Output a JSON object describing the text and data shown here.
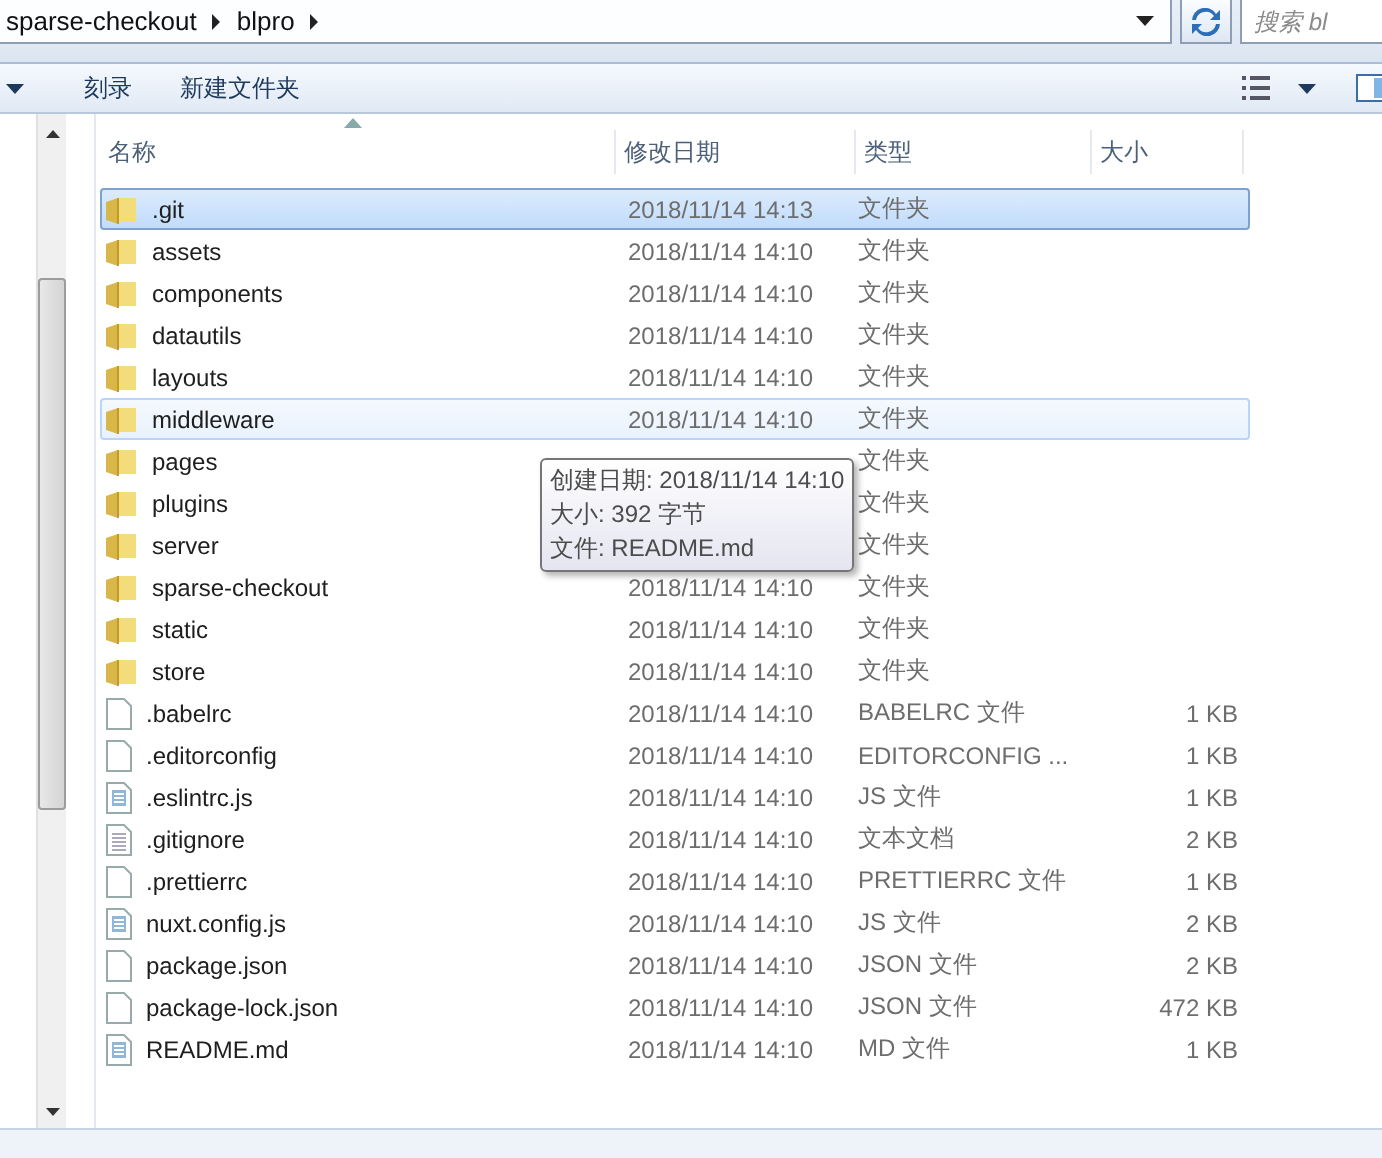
{
  "address_bar": {
    "crumbs": [
      "sparse-checkout",
      "blpro"
    ],
    "search_placeholder": "搜索 bl"
  },
  "toolbar": {
    "buttons": [
      "刻录",
      "新建文件夹"
    ]
  },
  "columns": [
    "名称",
    "修改日期",
    "类型",
    "大小"
  ],
  "files": [
    {
      "name": ".git",
      "date": "2018/11/14 14:13",
      "type": "文件夹",
      "kind": "folder",
      "selected": true,
      "hovered": false
    },
    {
      "name": "assets",
      "date": "2018/11/14 14:10",
      "type": "文件夹",
      "kind": "folder",
      "selected": false,
      "hovered": false
    },
    {
      "name": "components",
      "date": "2018/11/14 14:10",
      "type": "文件夹",
      "kind": "folder",
      "selected": false,
      "hovered": false
    },
    {
      "name": "datautils",
      "date": "2018/11/14 14:10",
      "type": "文件夹",
      "kind": "folder",
      "selected": false,
      "hovered": false
    },
    {
      "name": "layouts",
      "date": "2018/11/14 14:10",
      "type": "文件夹",
      "kind": "folder",
      "selected": false,
      "hovered": false
    },
    {
      "name": "middleware",
      "date": "2018/11/14 14:10",
      "type": "文件夹",
      "kind": "folder",
      "selected": false,
      "hovered": true
    },
    {
      "name": "pages",
      "type": "文件夹",
      "kind": "folder",
      "selected": false,
      "hovered": false
    },
    {
      "name": "plugins",
      "type": "文件夹",
      "kind": "folder",
      "selected": false,
      "hovered": false
    },
    {
      "name": "server",
      "type": "文件夹",
      "kind": "folder",
      "selected": false,
      "hovered": false
    },
    {
      "name": "sparse-checkout",
      "date": "2018/11/14 14:10",
      "type": "文件夹",
      "kind": "folder",
      "selected": false,
      "hovered": false
    },
    {
      "name": "static",
      "date": "2018/11/14 14:10",
      "type": "文件夹",
      "kind": "folder",
      "selected": false,
      "hovered": false
    },
    {
      "name": "store",
      "date": "2018/11/14 14:10",
      "type": "文件夹",
      "kind": "folder",
      "selected": false,
      "hovered": false
    },
    {
      "name": ".babelrc",
      "date": "2018/11/14 14:10",
      "type": "BABELRC 文件",
      "size": "1 KB",
      "kind": "blank",
      "selected": false,
      "hovered": false
    },
    {
      "name": ".editorconfig",
      "date": "2018/11/14 14:10",
      "type": "EDITORCONFIG ...",
      "size": "1 KB",
      "kind": "blank",
      "selected": false,
      "hovered": false
    },
    {
      "name": ".eslintrc.js",
      "date": "2018/11/14 14:10",
      "type": "JS 文件",
      "size": "1 KB",
      "kind": "script",
      "selected": false,
      "hovered": false
    },
    {
      "name": ".gitignore",
      "date": "2018/11/14 14:10",
      "type": "文本文档",
      "size": "2 KB",
      "kind": "text",
      "selected": false,
      "hovered": false
    },
    {
      "name": ".prettierrc",
      "date": "2018/11/14 14:10",
      "type": "PRETTIERRC 文件",
      "size": "1 KB",
      "kind": "blank",
      "selected": false,
      "hovered": false
    },
    {
      "name": "nuxt.config.js",
      "date": "2018/11/14 14:10",
      "type": "JS 文件",
      "size": "2 KB",
      "kind": "script",
      "selected": false,
      "hovered": false
    },
    {
      "name": "package.json",
      "date": "2018/11/14 14:10",
      "type": "JSON 文件",
      "size": "2 KB",
      "kind": "blank",
      "selected": false,
      "hovered": false
    },
    {
      "name": "package-lock.json",
      "date": "2018/11/14 14:10",
      "type": "JSON 文件",
      "size": "472 KB",
      "kind": "blank",
      "selected": false,
      "hovered": false
    },
    {
      "name": "README.md",
      "date": "2018/11/14 14:10",
      "type": "MD 文件",
      "size": "1 KB",
      "kind": "script",
      "selected": false,
      "hovered": false
    }
  ],
  "tooltip": [
    "创建日期: 2018/11/14 14:10",
    "大小: 392 字节",
    "文件: README.md"
  ]
}
